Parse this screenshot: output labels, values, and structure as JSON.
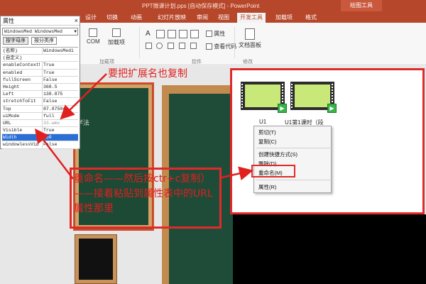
{
  "window": {
    "file_title": "PPT微课计划.pps [自动保存模式] - PowerPoint",
    "context_tab_group": "绘图工具"
  },
  "ribbon": {
    "tabs": [
      "设计",
      "切换",
      "动画",
      "幻灯片放映",
      "审阅",
      "视图",
      "开发工具",
      "加载项",
      "格式"
    ],
    "active_tab": "开发工具",
    "buttons": {
      "com": "COM",
      "addins": "加载项",
      "addins_group": "加载项",
      "properties": "属性",
      "view_code": "查看代码",
      "controls_group": "控件",
      "document_panel": "文档面板",
      "modify_group": "修改"
    }
  },
  "properties_panel": {
    "title": "属性",
    "object_selector": "WindowsMed WindowsMed",
    "tabs": [
      "按字母序",
      "按分类序"
    ],
    "rows": [
      {
        "key": "(名称)",
        "value": "WindowsMedi"
      },
      {
        "key": "(自定义)",
        "value": ""
      },
      {
        "key": "enableContextM",
        "value": "True"
      },
      {
        "key": "enabled",
        "value": "True"
      },
      {
        "key": "fullScreen",
        "value": "False"
      },
      {
        "key": "Height",
        "value": "368.5"
      },
      {
        "key": "Left",
        "value": "138.875"
      },
      {
        "key": "stretchToFit",
        "value": "False"
      },
      {
        "key": "Top",
        "value": "87.87504"
      },
      {
        "key": "uiMode",
        "value": "full"
      },
      {
        "key": "URL",
        "value": "33.wmv"
      },
      {
        "key": "Visible",
        "value": "True"
      },
      {
        "key": "Width",
        "value": "550"
      },
      {
        "key": "windowlessVid",
        "value": "False"
      }
    ]
  },
  "annotations": {
    "top": "要把扩展名也复制",
    "bottom": "重命名——然后按ctr+c复制）——接着粘贴到属性表中的URL属性那里"
  },
  "slide": {
    "faint_label": "学法"
  },
  "explorer": {
    "files": [
      {
        "name": "U1"
      },
      {
        "name": "U1第1课时（段"
      }
    ]
  },
  "context_menu": {
    "items": [
      "剪切(T)",
      "复制(C)",
      "创建快捷方式(S)",
      "删除(D)",
      "重命名(M)",
      "属性(R)"
    ]
  },
  "colors": {
    "accent_red": "#e02a2a",
    "ribbon": "#b7472a",
    "board_green": "#1e4c38",
    "frame_wood": "#c38a4e"
  }
}
